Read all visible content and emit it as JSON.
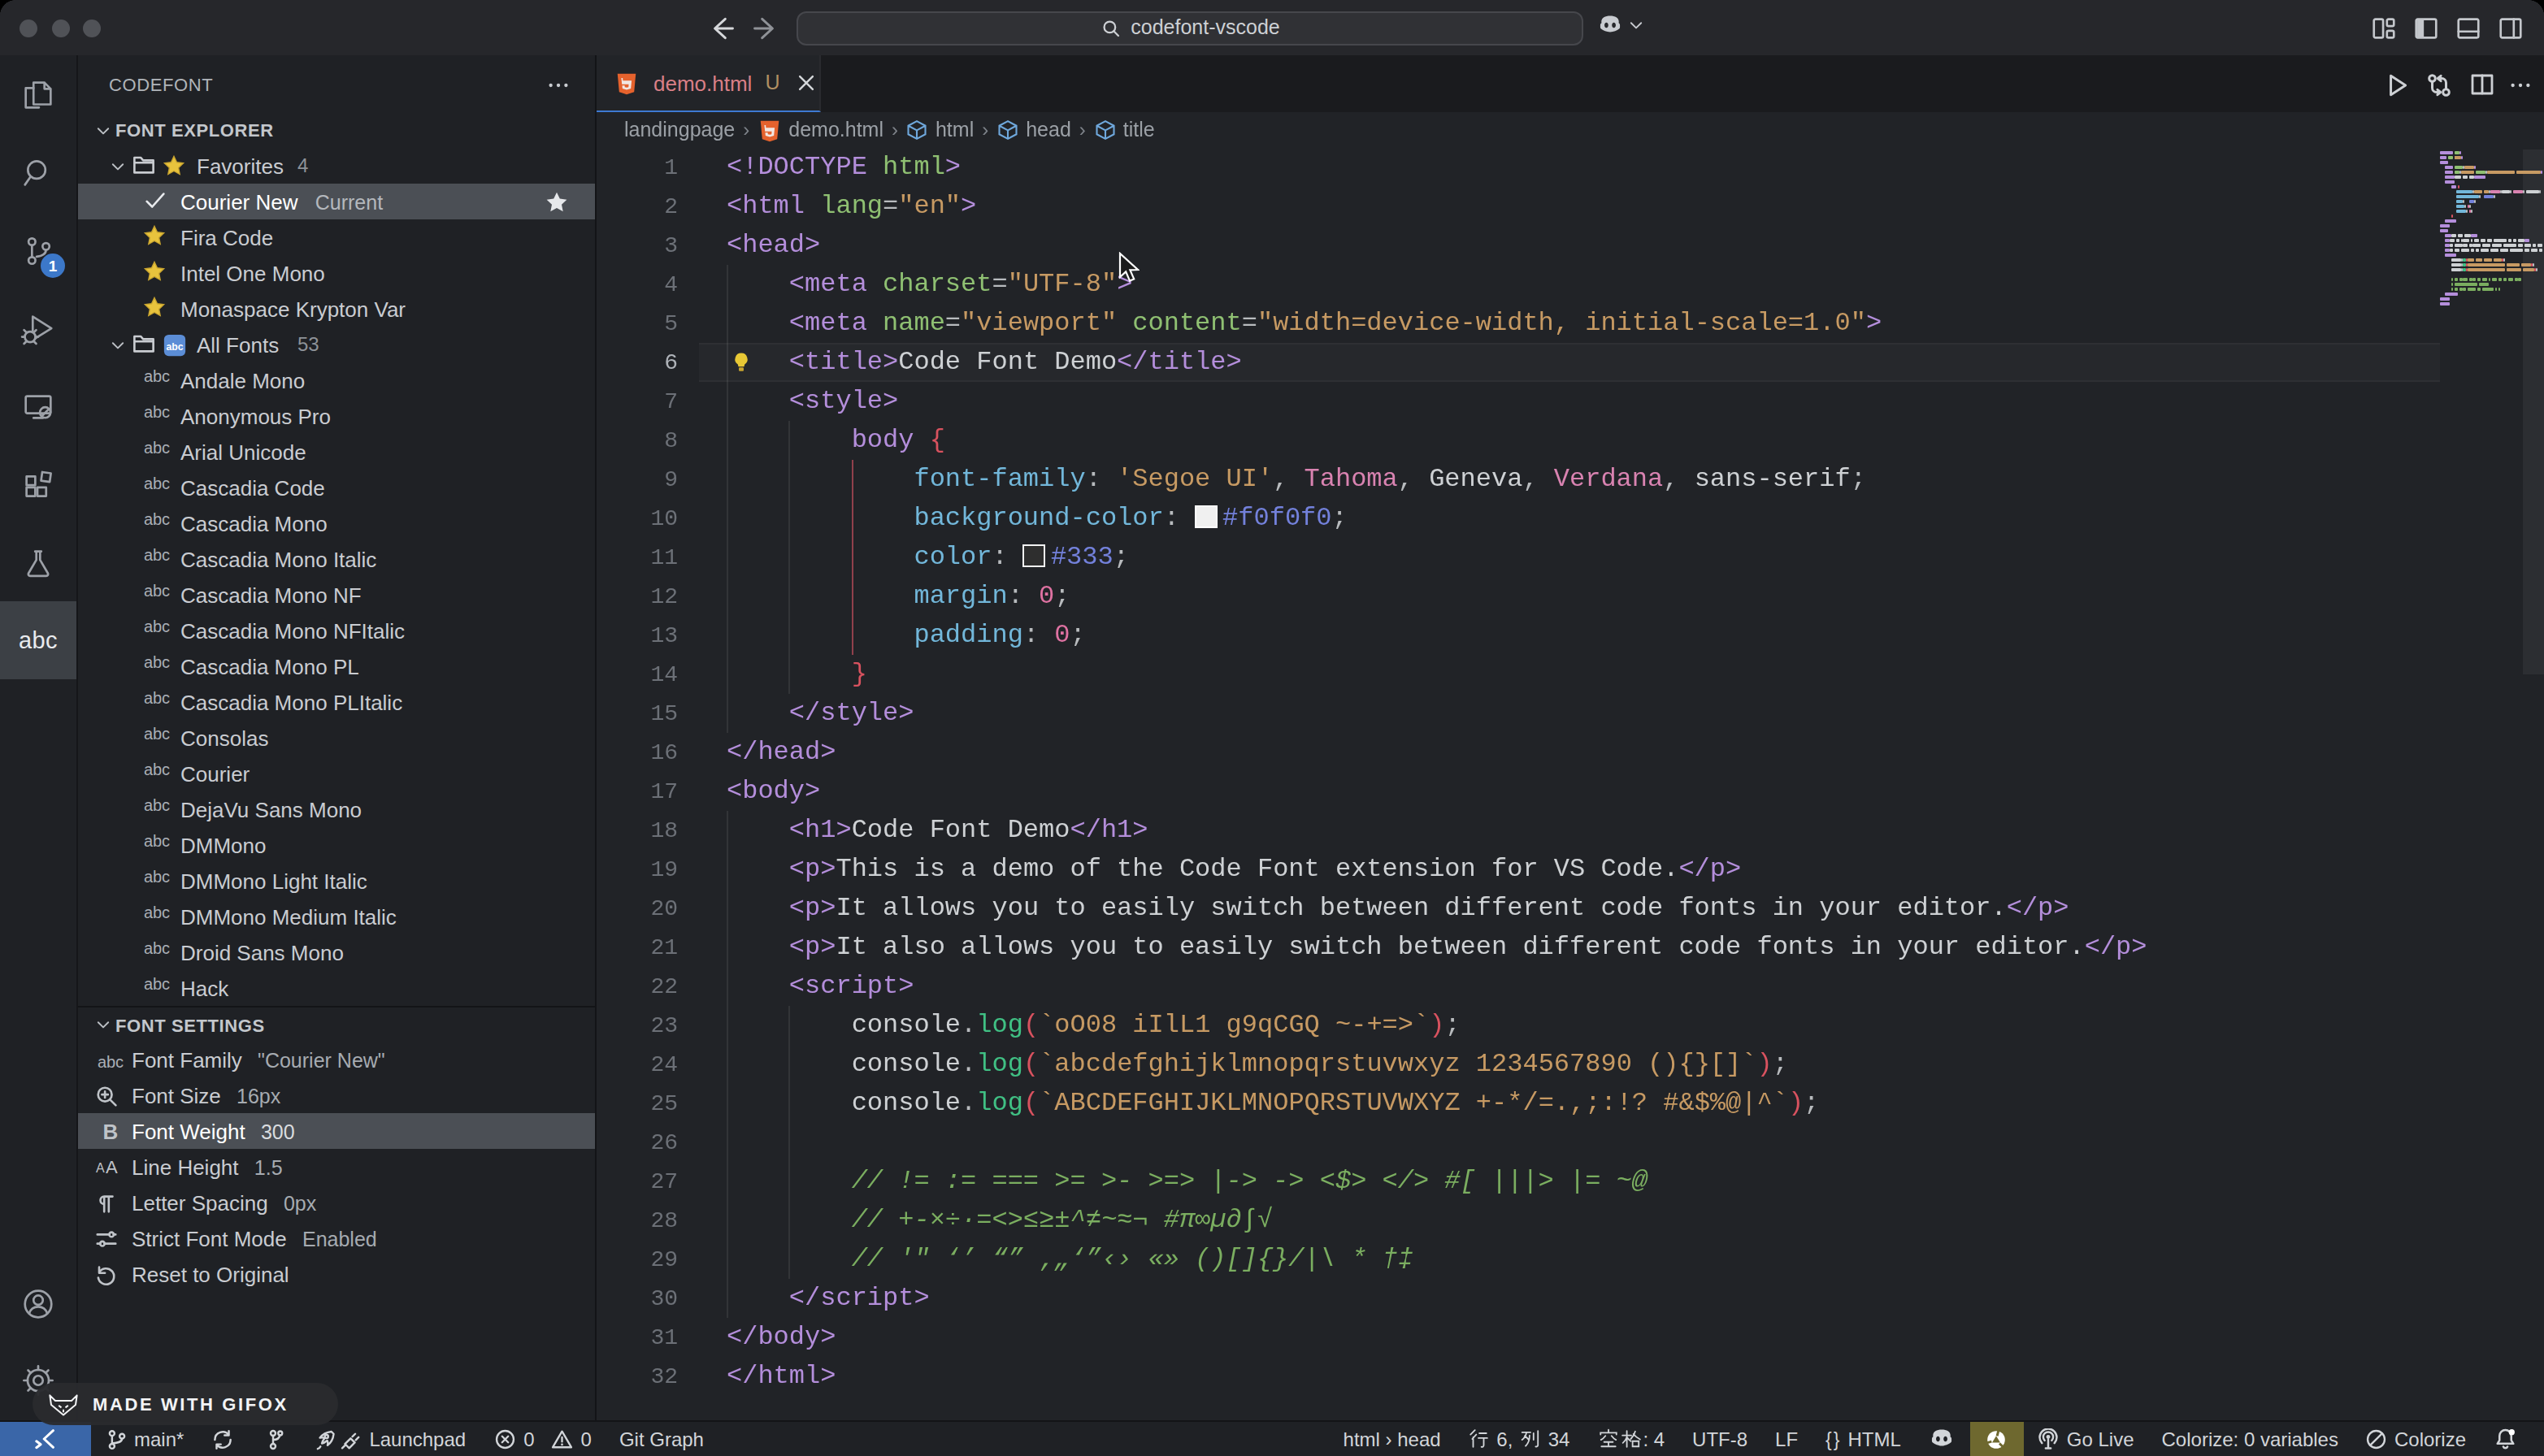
{
  "title_bar": {
    "search_value": "codefont-vscode",
    "window_controls": [
      "close",
      "minimize",
      "zoom"
    ],
    "nav": {
      "back": "back-arrow",
      "forward": "forward-arrow"
    },
    "copilot_menu": "copilot",
    "layout_buttons": [
      "customize-layout",
      "toggle-primary-sidebar",
      "toggle-panel",
      "toggle-secondary-sidebar"
    ]
  },
  "activity_bar": {
    "items": [
      {
        "name": "explorer",
        "icon": "files"
      },
      {
        "name": "search",
        "icon": "search"
      },
      {
        "name": "source-control",
        "icon": "source-control",
        "badge": "1"
      },
      {
        "name": "run-and-debug",
        "icon": "debug"
      },
      {
        "name": "remote-explorer",
        "icon": "remote-explorer"
      },
      {
        "name": "extensions",
        "icon": "extensions"
      },
      {
        "name": "testing",
        "icon": "beaker"
      },
      {
        "name": "codefont",
        "icon": "abc-text",
        "active": true
      }
    ],
    "bottom_items": [
      {
        "name": "accounts",
        "icon": "account"
      },
      {
        "name": "settings",
        "icon": "gear"
      }
    ]
  },
  "sidebar": {
    "title": "CODEFONT",
    "title_menu": "ellipsis",
    "explorer": {
      "header": "FONT EXPLORER",
      "rows": [
        {
          "type": "folder",
          "icon": "star-emoji",
          "label": "Favorites",
          "count": "4",
          "expanded": true
        },
        {
          "type": "font",
          "icon": "check",
          "label": "Courier New",
          "description": "Current",
          "selected": true,
          "right_icon": "star-filled"
        },
        {
          "type": "font",
          "icon": "star-emoji",
          "label": "Fira Code"
        },
        {
          "type": "font",
          "icon": "star-emoji",
          "label": "Intel One Mono"
        },
        {
          "type": "font",
          "icon": "star-emoji",
          "label": "Monaspace Krypton Var"
        },
        {
          "type": "folder",
          "icon": "abc-emoji",
          "label": "All Fonts",
          "count": "53",
          "expanded": true
        },
        {
          "type": "font",
          "icon": "abc-codicon",
          "label": "Andale Mono"
        },
        {
          "type": "font",
          "icon": "abc-codicon",
          "label": "Anonymous Pro"
        },
        {
          "type": "font",
          "icon": "abc-codicon",
          "label": "Arial Unicode"
        },
        {
          "type": "font",
          "icon": "abc-codicon",
          "label": "Cascadia Code"
        },
        {
          "type": "font",
          "icon": "abc-codicon",
          "label": "Cascadia Mono"
        },
        {
          "type": "font",
          "icon": "abc-codicon",
          "label": "Cascadia Mono Italic"
        },
        {
          "type": "font",
          "icon": "abc-codicon",
          "label": "Cascadia Mono NF"
        },
        {
          "type": "font",
          "icon": "abc-codicon",
          "label": "Cascadia Mono NFItalic"
        },
        {
          "type": "font",
          "icon": "abc-codicon",
          "label": "Cascadia Mono PL"
        },
        {
          "type": "font",
          "icon": "abc-codicon",
          "label": "Cascadia Mono PLItalic"
        },
        {
          "type": "font",
          "icon": "abc-codicon",
          "label": "Consolas"
        },
        {
          "type": "font",
          "icon": "abc-codicon",
          "label": "Courier"
        },
        {
          "type": "font",
          "icon": "abc-codicon",
          "label": "DejaVu Sans Mono"
        },
        {
          "type": "font",
          "icon": "abc-codicon",
          "label": "DMMono"
        },
        {
          "type": "font",
          "icon": "abc-codicon",
          "label": "DMMono Light Italic"
        },
        {
          "type": "font",
          "icon": "abc-codicon",
          "label": "DMMono Medium Italic"
        },
        {
          "type": "font",
          "icon": "abc-codicon",
          "label": "Droid Sans Mono"
        },
        {
          "type": "font",
          "icon": "abc-codicon",
          "label": "Hack"
        }
      ]
    },
    "settings": {
      "header": "FONT SETTINGS",
      "rows": [
        {
          "icon": "abc-codicon",
          "label": "Font Family",
          "value": "\"Courier New\""
        },
        {
          "icon": "zoom-in",
          "label": "Font Size",
          "value": "16px"
        },
        {
          "icon": "bold-b",
          "label": "Font Weight",
          "value": "300",
          "selected": true
        },
        {
          "icon": "line-height",
          "label": "Line Height",
          "value": "1.5"
        },
        {
          "icon": "pilcrow",
          "label": "Letter Spacing",
          "value": "0px"
        },
        {
          "icon": "sliders",
          "label": "Strict Font Mode",
          "value": "Enabled"
        },
        {
          "icon": "reset",
          "label": "Reset to Original",
          "value": ""
        }
      ]
    }
  },
  "editor": {
    "tab": {
      "icon": "html5",
      "filename": "demo.html",
      "git_status": "U",
      "close": "close-x"
    },
    "actions": [
      "run",
      "open-changes",
      "split-editor",
      "ellipsis"
    ],
    "breadcrumbs": [
      {
        "label": "landingpage"
      },
      {
        "label": "demo.html",
        "icon": "html5"
      },
      {
        "label": "html",
        "icon": "symbol-cube"
      },
      {
        "label": "head",
        "icon": "symbol-cube"
      },
      {
        "label": "title",
        "icon": "symbol-cube"
      }
    ],
    "cursor_line": 6,
    "lightbulb_line": 6,
    "code_lines": [
      {
        "n": 1,
        "guides": [],
        "tokens": [
          [
            "tag",
            "<!DOCTYPE "
          ],
          [
            "attr",
            "html"
          ],
          [
            "tag",
            ">"
          ]
        ]
      },
      {
        "n": 2,
        "guides": [],
        "tokens": [
          [
            "tag",
            "<html "
          ],
          [
            "attr",
            "lang"
          ],
          [
            "punct",
            "="
          ],
          [
            "str",
            "\"en\""
          ],
          [
            "tag",
            ">"
          ]
        ]
      },
      {
        "n": 3,
        "guides": [],
        "tokens": [
          [
            "tag",
            "<head>"
          ]
        ]
      },
      {
        "n": 4,
        "guides": [
          0
        ],
        "tokens": [
          [
            "tag",
            "    <meta "
          ],
          [
            "attr",
            "charset"
          ],
          [
            "punct",
            "="
          ],
          [
            "str",
            "\"UTF-8\""
          ],
          [
            "tag",
            ">"
          ]
        ]
      },
      {
        "n": 5,
        "guides": [
          0
        ],
        "tokens": [
          [
            "tag",
            "    <meta "
          ],
          [
            "attr",
            "name"
          ],
          [
            "punct",
            "="
          ],
          [
            "str",
            "\"viewport\""
          ],
          [
            "attr",
            " content"
          ],
          [
            "punct",
            "="
          ],
          [
            "str",
            "\"width=device-width, initial-scale=1.0\""
          ],
          [
            "tag",
            ">"
          ]
        ]
      },
      {
        "n": 6,
        "guides": [
          0
        ],
        "tokens": [
          [
            "tag",
            "    <title>"
          ],
          [
            "text",
            "Code Font Demo"
          ],
          [
            "tag",
            "</title>"
          ]
        ]
      },
      {
        "n": 7,
        "guides": [
          0
        ],
        "tokens": [
          [
            "tag",
            "    <style>"
          ]
        ]
      },
      {
        "n": 8,
        "guides": [
          0,
          4
        ],
        "tokens": [
          [
            "tag",
            "        body "
          ],
          [
            "brace",
            "{"
          ]
        ]
      },
      {
        "n": 9,
        "guides": [
          0,
          4
        ],
        "red_guide": 8,
        "tokens": [
          [
            "prop",
            "            font-family"
          ],
          [
            "punct",
            ": "
          ],
          [
            "str",
            "'Segoe UI'"
          ],
          [
            "punct",
            ", "
          ],
          [
            "fontname",
            "Tahoma"
          ],
          [
            "punct",
            ", "
          ],
          [
            "text",
            "Geneva"
          ],
          [
            "punct",
            ", "
          ],
          [
            "fontname",
            "Verdana"
          ],
          [
            "punct",
            ", "
          ],
          [
            "text",
            "sans-serif"
          ],
          [
            "punct",
            ";"
          ]
        ]
      },
      {
        "n": 10,
        "guides": [
          0,
          4
        ],
        "red_guide": 8,
        "tokens": [
          [
            "prop",
            "            background-color"
          ],
          [
            "punct",
            ": "
          ],
          [
            "swatch-light",
            ""
          ],
          [
            "hex",
            "#f0f0f0"
          ],
          [
            "punct",
            ";"
          ]
        ]
      },
      {
        "n": 11,
        "guides": [
          0,
          4
        ],
        "red_guide": 8,
        "tokens": [
          [
            "prop",
            "            color"
          ],
          [
            "punct",
            ": "
          ],
          [
            "swatch-dark",
            ""
          ],
          [
            "hex",
            "#333"
          ],
          [
            "punct",
            ";"
          ]
        ]
      },
      {
        "n": 12,
        "guides": [
          0,
          4
        ],
        "red_guide": 8,
        "tokens": [
          [
            "prop",
            "            margin"
          ],
          [
            "punct",
            ": "
          ],
          [
            "num",
            "0"
          ],
          [
            "punct",
            ";"
          ]
        ]
      },
      {
        "n": 13,
        "guides": [
          0,
          4
        ],
        "red_guide": 8,
        "tokens": [
          [
            "prop",
            "            padding"
          ],
          [
            "punct",
            ": "
          ],
          [
            "num",
            "0"
          ],
          [
            "punct",
            ";"
          ]
        ]
      },
      {
        "n": 14,
        "guides": [
          0,
          4
        ],
        "tokens": [
          [
            "brace",
            "        }"
          ]
        ]
      },
      {
        "n": 15,
        "guides": [
          0
        ],
        "tokens": [
          [
            "tag",
            "    </style>"
          ]
        ]
      },
      {
        "n": 16,
        "guides": [],
        "tokens": [
          [
            "tag",
            "</head>"
          ]
        ]
      },
      {
        "n": 17,
        "guides": [],
        "tokens": [
          [
            "tag",
            "<body>"
          ]
        ]
      },
      {
        "n": 18,
        "guides": [
          0
        ],
        "tokens": [
          [
            "tag",
            "    <h1>"
          ],
          [
            "text",
            "Code Font Demo"
          ],
          [
            "tag",
            "</h1>"
          ]
        ]
      },
      {
        "n": 19,
        "guides": [
          0
        ],
        "tokens": [
          [
            "tag",
            "    <p>"
          ],
          [
            "text",
            "This is a demo of the Code Font extension for VS Code."
          ],
          [
            "tag",
            "</p>"
          ]
        ]
      },
      {
        "n": 20,
        "guides": [
          0
        ],
        "tokens": [
          [
            "tag",
            "    <p>"
          ],
          [
            "text",
            "It allows you to easily switch between different code fonts in your editor."
          ],
          [
            "tag",
            "</p>"
          ]
        ]
      },
      {
        "n": 21,
        "guides": [
          0
        ],
        "tokens": [
          [
            "tag",
            "    <p>"
          ],
          [
            "text",
            "It also allows you to easily switch between different code fonts in your editor."
          ],
          [
            "tag",
            "</p>"
          ]
        ]
      },
      {
        "n": 22,
        "guides": [
          0
        ],
        "tokens": [
          [
            "tag",
            "    <script>"
          ]
        ]
      },
      {
        "n": 23,
        "guides": [
          0,
          4
        ],
        "tokens": [
          [
            "obj",
            "        console"
          ],
          [
            "punct",
            "."
          ],
          [
            "fn",
            "log"
          ],
          [
            "brace",
            "("
          ],
          [
            "str",
            "`oO08 iIlL1 g9qCGQ ~-+=>`"
          ],
          [
            "brace",
            ")"
          ],
          [
            "punct",
            ";"
          ]
        ]
      },
      {
        "n": 24,
        "guides": [
          0,
          4
        ],
        "tokens": [
          [
            "obj",
            "        console"
          ],
          [
            "punct",
            "."
          ],
          [
            "fn",
            "log"
          ],
          [
            "brace",
            "("
          ],
          [
            "str",
            "`abcdefghijklmnopqrstuvwxyz 1234567890 (){}[]`"
          ],
          [
            "brace",
            ")"
          ],
          [
            "punct",
            ";"
          ]
        ]
      },
      {
        "n": 25,
        "guides": [
          0,
          4
        ],
        "tokens": [
          [
            "obj",
            "        console"
          ],
          [
            "punct",
            "."
          ],
          [
            "fn",
            "log"
          ],
          [
            "brace",
            "("
          ],
          [
            "str",
            "`ABCDEFGHIJKLMNOPQRSTUVWXYZ +-*/=.,;:!? #&$%@|^`"
          ],
          [
            "brace",
            ")"
          ],
          [
            "punct",
            ";"
          ]
        ]
      },
      {
        "n": 26,
        "guides": [
          0,
          4
        ],
        "tokens": []
      },
      {
        "n": 27,
        "guides": [
          0,
          4
        ],
        "tokens": [
          [
            "cmt",
            "        // != := === >= >- >=> |-> -> <$> </> #[ |||> |= ~@"
          ]
        ]
      },
      {
        "n": 28,
        "guides": [
          0,
          4
        ],
        "tokens": [
          [
            "cmt",
            "        // +-×÷·=<>≤≥±^≠~≈¬ #π∞µ∂∫√"
          ]
        ]
      },
      {
        "n": 29,
        "guides": [
          0,
          4
        ],
        "tokens": [
          [
            "cmt",
            "        // '\" ‘’ “” ‚„‘”‹› «» ()[]{}/|\\ * †‡"
          ]
        ]
      },
      {
        "n": 30,
        "guides": [
          0
        ],
        "tokens": [
          [
            "tag",
            "    </script>"
          ]
        ]
      },
      {
        "n": 31,
        "guides": [],
        "tokens": [
          [
            "tag",
            "</body>"
          ]
        ]
      },
      {
        "n": 32,
        "guides": [],
        "tokens": [
          [
            "tag",
            "</html>"
          ]
        ]
      }
    ],
    "token_colors": {
      "tag": "#B48EDB",
      "attr": "#8FC072",
      "str": "#C79A63",
      "text": "#CED1D4",
      "punct": "#B8BBBE",
      "prop": "#72B7DA",
      "num": "#DF72A2",
      "hex": "#7381DB",
      "brace": "#D8525F",
      "fn": "#40C084",
      "cmt": "#7BAE60",
      "obj": "#CED1D4",
      "fontname": "#D983B1",
      "swatch-light": "#F0F0F0",
      "swatch-dark": "#2E2E2E"
    }
  },
  "status_bar": {
    "left": [
      {
        "name": "remote-indicator",
        "icon": "remote-bracket",
        "style": "remote"
      },
      {
        "name": "git-branch",
        "icon": "branch",
        "label": "main*"
      },
      {
        "name": "sync",
        "icon": "sync"
      },
      {
        "name": "commit-graph",
        "icon": "commit-graph"
      },
      {
        "name": "launchpad",
        "icon": "rocket-plug",
        "label": "Launchpad"
      },
      {
        "name": "problems",
        "icon": "error-warning",
        "errors": "0",
        "warnings": "0"
      },
      {
        "name": "git-graph",
        "label": "Git Graph"
      }
    ],
    "right": [
      {
        "name": "breadcrumb-path",
        "label": "html › head"
      },
      {
        "name": "cursor-position",
        "label": "行 6，列 34",
        "cjk": "line-col"
      },
      {
        "name": "indentation",
        "label": "空格: 4",
        "cjk": "spaces"
      },
      {
        "name": "encoding",
        "label": "UTF-8"
      },
      {
        "name": "eol",
        "label": "LF"
      },
      {
        "name": "language-mode",
        "label": "HTML",
        "prefix": "{}"
      },
      {
        "name": "copilot-status",
        "icon": "copilot"
      },
      {
        "name": "extension-status",
        "icon": "knot",
        "style": "olive"
      },
      {
        "name": "go-live",
        "icon": "radio-tower",
        "label": "Go Live"
      },
      {
        "name": "colorize-variables",
        "label": "Colorize: 0 variables"
      },
      {
        "name": "colorize-toggle",
        "icon": "slash-circle",
        "label": "Colorize"
      },
      {
        "name": "notifications",
        "icon": "bell-dot"
      }
    ]
  },
  "badge": {
    "label": "MADE WITH GIFOX",
    "icon": "fox"
  }
}
